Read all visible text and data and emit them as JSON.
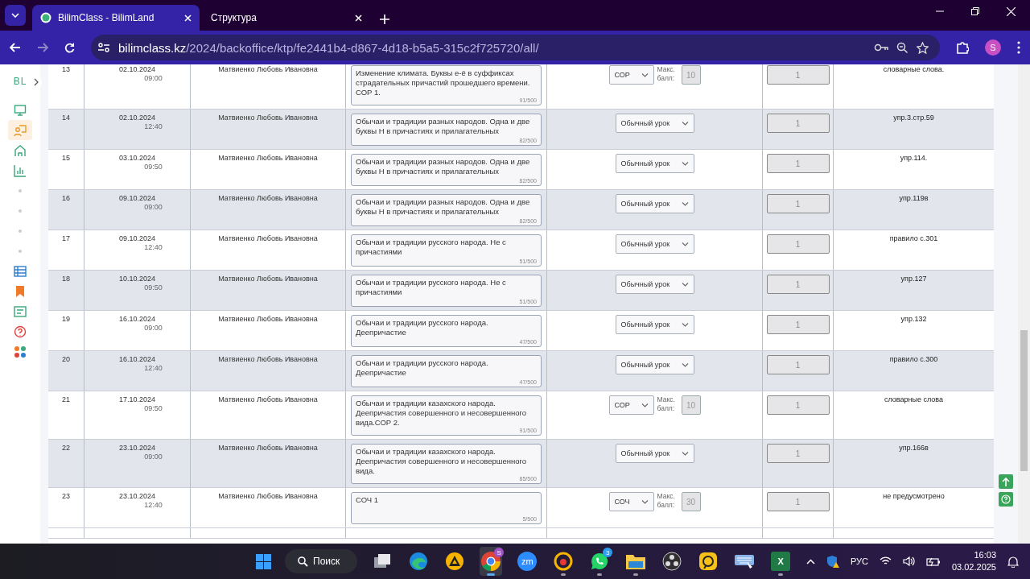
{
  "browser": {
    "tabs": [
      {
        "title": "BilimClass - BilimLand",
        "selected": true
      },
      {
        "title": "Структура",
        "selected": false
      }
    ],
    "address": {
      "host": "bilimclass.kz",
      "path": "/2024/backoffice/ktp/fe2441b4-d867-4d18-b5a5-315c2f725720/all/"
    },
    "profile": "S"
  },
  "sidebar": {
    "logo": "BL",
    "items": [
      {
        "selected": false
      },
      {
        "selected": true
      },
      {
        "selected": false
      },
      {
        "selected": false
      },
      {
        "selected": false
      },
      {
        "selected": false
      },
      {
        "selected": false
      },
      {
        "selected": false
      },
      {
        "selected": false
      },
      {
        "selected": false
      },
      {
        "selected": false
      },
      {
        "selected": false
      },
      {
        "selected": false
      }
    ]
  },
  "table": {
    "rows": [
      {
        "num": "13",
        "date": "02.10.2024",
        "time": "09:00",
        "teacher": "Матвиенко Любовь Ивановна",
        "topic": "Изменение климата. Буквы е-ё в суффиксах страдательных причастий прошедшего времени. СОР 1.",
        "counter": "91/500",
        "type": {
          "kind": "assessment",
          "value": "СОР",
          "max_label": "Макс. балл:",
          "max": "10"
        },
        "hours": "1",
        "homework": "словарные слова."
      },
      {
        "num": "14",
        "date": "02.10.2024",
        "time": "12:40",
        "teacher": "Матвиенко Любовь Ивановна",
        "topic": "Обычаи и традиции разных народов. Одна и две буквы Н в причастиях и прилагательных",
        "counter": "82/500",
        "type": {
          "kind": "regular",
          "value": "Обычный урок"
        },
        "hours": "1",
        "homework": "упр.3.стр.59"
      },
      {
        "num": "15",
        "date": "03.10.2024",
        "time": "09:50",
        "teacher": "Матвиенко Любовь Ивановна",
        "topic": "Обычаи и традиции разных народов. Одна и две буквы Н в причастиях и прилагательных",
        "counter": "82/500",
        "type": {
          "kind": "regular",
          "value": "Обычный урок"
        },
        "hours": "1",
        "homework": "упр.114."
      },
      {
        "num": "16",
        "date": "09.10.2024",
        "time": "09:00",
        "teacher": "Матвиенко Любовь Ивановна",
        "topic": "Обычаи и традиции разных народов. Одна и две буквы Н в причастиях и прилагательных",
        "counter": "82/500",
        "type": {
          "kind": "regular",
          "value": "Обычный урок"
        },
        "hours": "1",
        "homework": "упр.119в"
      },
      {
        "num": "17",
        "date": "09.10.2024",
        "time": "12:40",
        "teacher": "Матвиенко Любовь Ивановна",
        "topic": "Обычаи и традиции русского народа. Не с причастиями",
        "counter": "51/500",
        "type": {
          "kind": "regular",
          "value": "Обычный урок"
        },
        "hours": "1",
        "homework": "правило с.301"
      },
      {
        "num": "18",
        "date": "10.10.2024",
        "time": "09:50",
        "teacher": "Матвиенко Любовь Ивановна",
        "topic": "Обычаи и традиции русского народа. Не с причастиями",
        "counter": "51/500",
        "type": {
          "kind": "regular",
          "value": "Обычный урок"
        },
        "hours": "1",
        "homework": "упр.127"
      },
      {
        "num": "19",
        "date": "16.10.2024",
        "time": "09:00",
        "teacher": "Матвиенко Любовь Ивановна",
        "topic": "Обычаи и традиции русского народа. Деепричастие",
        "counter": "47/500",
        "type": {
          "kind": "regular",
          "value": "Обычный урок"
        },
        "hours": "1",
        "homework": "упр.132"
      },
      {
        "num": "20",
        "date": "16.10.2024",
        "time": "12:40",
        "teacher": "Матвиенко Любовь Ивановна",
        "topic": "Обычаи и традиции русского народа. Деепричастие",
        "counter": "47/500",
        "type": {
          "kind": "regular",
          "value": "Обычный урок"
        },
        "hours": "1",
        "homework": "правило с.300"
      },
      {
        "num": "21",
        "date": "17.10.2024",
        "time": "09:50",
        "teacher": "Матвиенко Любовь Ивановна",
        "topic": "Обычаи и традиции казахского народа. Деепричастия совершенного и несовершенного вида.СОР 2.",
        "counter": "91/500",
        "type": {
          "kind": "assessment",
          "value": "СОР",
          "max_label": "Макс. балл:",
          "max": "10"
        },
        "hours": "1",
        "homework": "словарные слова"
      },
      {
        "num": "22",
        "date": "23.10.2024",
        "time": "09:00",
        "teacher": "Матвиенко Любовь Ивановна",
        "topic": "Обычаи и традиции казахского народа. Деепричастия совершенного и несовершенного вида.",
        "counter": "85/500",
        "type": {
          "kind": "regular",
          "value": "Обычный урок"
        },
        "hours": "1",
        "homework": "упр.166в"
      },
      {
        "num": "23",
        "date": "23.10.2024",
        "time": "12:40",
        "teacher": "Матвиенко Любовь Ивановна",
        "topic": "СОЧ 1",
        "counter": "5/500",
        "type": {
          "kind": "assessment",
          "value": "СОЧ",
          "max_label": "Макс. балл:",
          "max": "30"
        },
        "hours": "1",
        "homework": "не предусмотрено"
      }
    ]
  },
  "taskbar": {
    "search": "Поиск",
    "apps": [
      {
        "running": false
      },
      {
        "running": false
      },
      {
        "running": false
      },
      {
        "badge": "S",
        "selected": true,
        "running": true
      },
      {
        "label": "zm",
        "running": false
      },
      {
        "running": true
      },
      {
        "badge": "3",
        "running": true
      },
      {
        "running": true
      },
      {
        "running": false
      },
      {
        "running": false
      },
      {
        "running": false
      },
      {
        "label": "X",
        "running": true
      }
    ],
    "language": "РУС",
    "time": "16:03",
    "date": "03.02.2025"
  }
}
